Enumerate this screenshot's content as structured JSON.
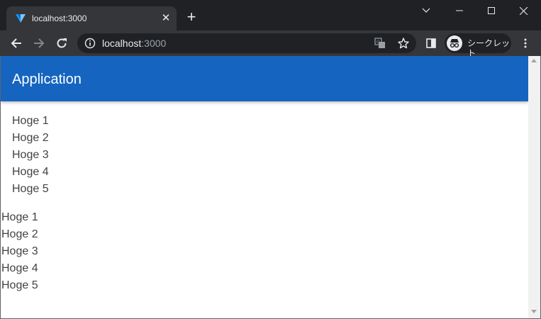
{
  "browser": {
    "tab": {
      "title": "localhost:3000",
      "close_glyph": "✕",
      "favicon": "vuetify-icon"
    },
    "new_tab_glyph": "+",
    "window_controls": {
      "tab_search": "chevron-down-icon",
      "minimize": "minimize-icon",
      "maximize": "maximize-icon",
      "close": "close-icon"
    },
    "omnibox": {
      "host": "localhost",
      "port": ":3000"
    },
    "profile": {
      "label": "シークレット",
      "icon": "incognito-icon"
    }
  },
  "app": {
    "title": "Application",
    "list_indented": [
      "Hoge 1",
      "Hoge 2",
      "Hoge 3",
      "Hoge 4",
      "Hoge 5"
    ],
    "list_plain": [
      "Hoge 1",
      "Hoge 2",
      "Hoge 3",
      "Hoge 4",
      "Hoge 5"
    ]
  },
  "colors": {
    "app_bar": "#1565c0",
    "tab_strip": "#202124",
    "toolbar": "#35363a",
    "text": "#424242"
  }
}
